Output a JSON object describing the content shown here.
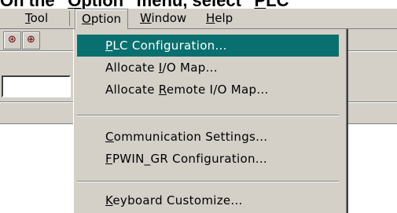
{
  "caption": {
    "pre": "On the \"",
    "accel": "O",
    "post": "ption\" menu, select \"",
    "accel2": "P",
    "post2": "LC"
  },
  "menubar": {
    "items": [
      {
        "accel": "T",
        "rest": "ool"
      },
      {
        "accel": "O",
        "rest": "ption"
      },
      {
        "accel": "W",
        "rest": "indow"
      },
      {
        "accel": "H",
        "rest": "elp"
      }
    ]
  },
  "toolbar": {
    "buttons": [
      "plug-icon",
      "plug-icon"
    ]
  },
  "menu": {
    "items": [
      {
        "pre": "",
        "accel": "P",
        "post": "LC Configuration..."
      },
      {
        "pre": "Allocate ",
        "accel": "I",
        "post": "/O Map..."
      },
      {
        "pre": "Allocate ",
        "accel": "R",
        "post": "emote I/O Map..."
      },
      {
        "pre": "",
        "accel": "C",
        "post": "ommunication Settings..."
      },
      {
        "pre": "",
        "accel": "F",
        "post": "PWIN_GR Configuration..."
      },
      {
        "pre": "",
        "accel": "K",
        "post": "eyboard Customize..."
      }
    ],
    "highlight_color": "#0a6f6f"
  }
}
